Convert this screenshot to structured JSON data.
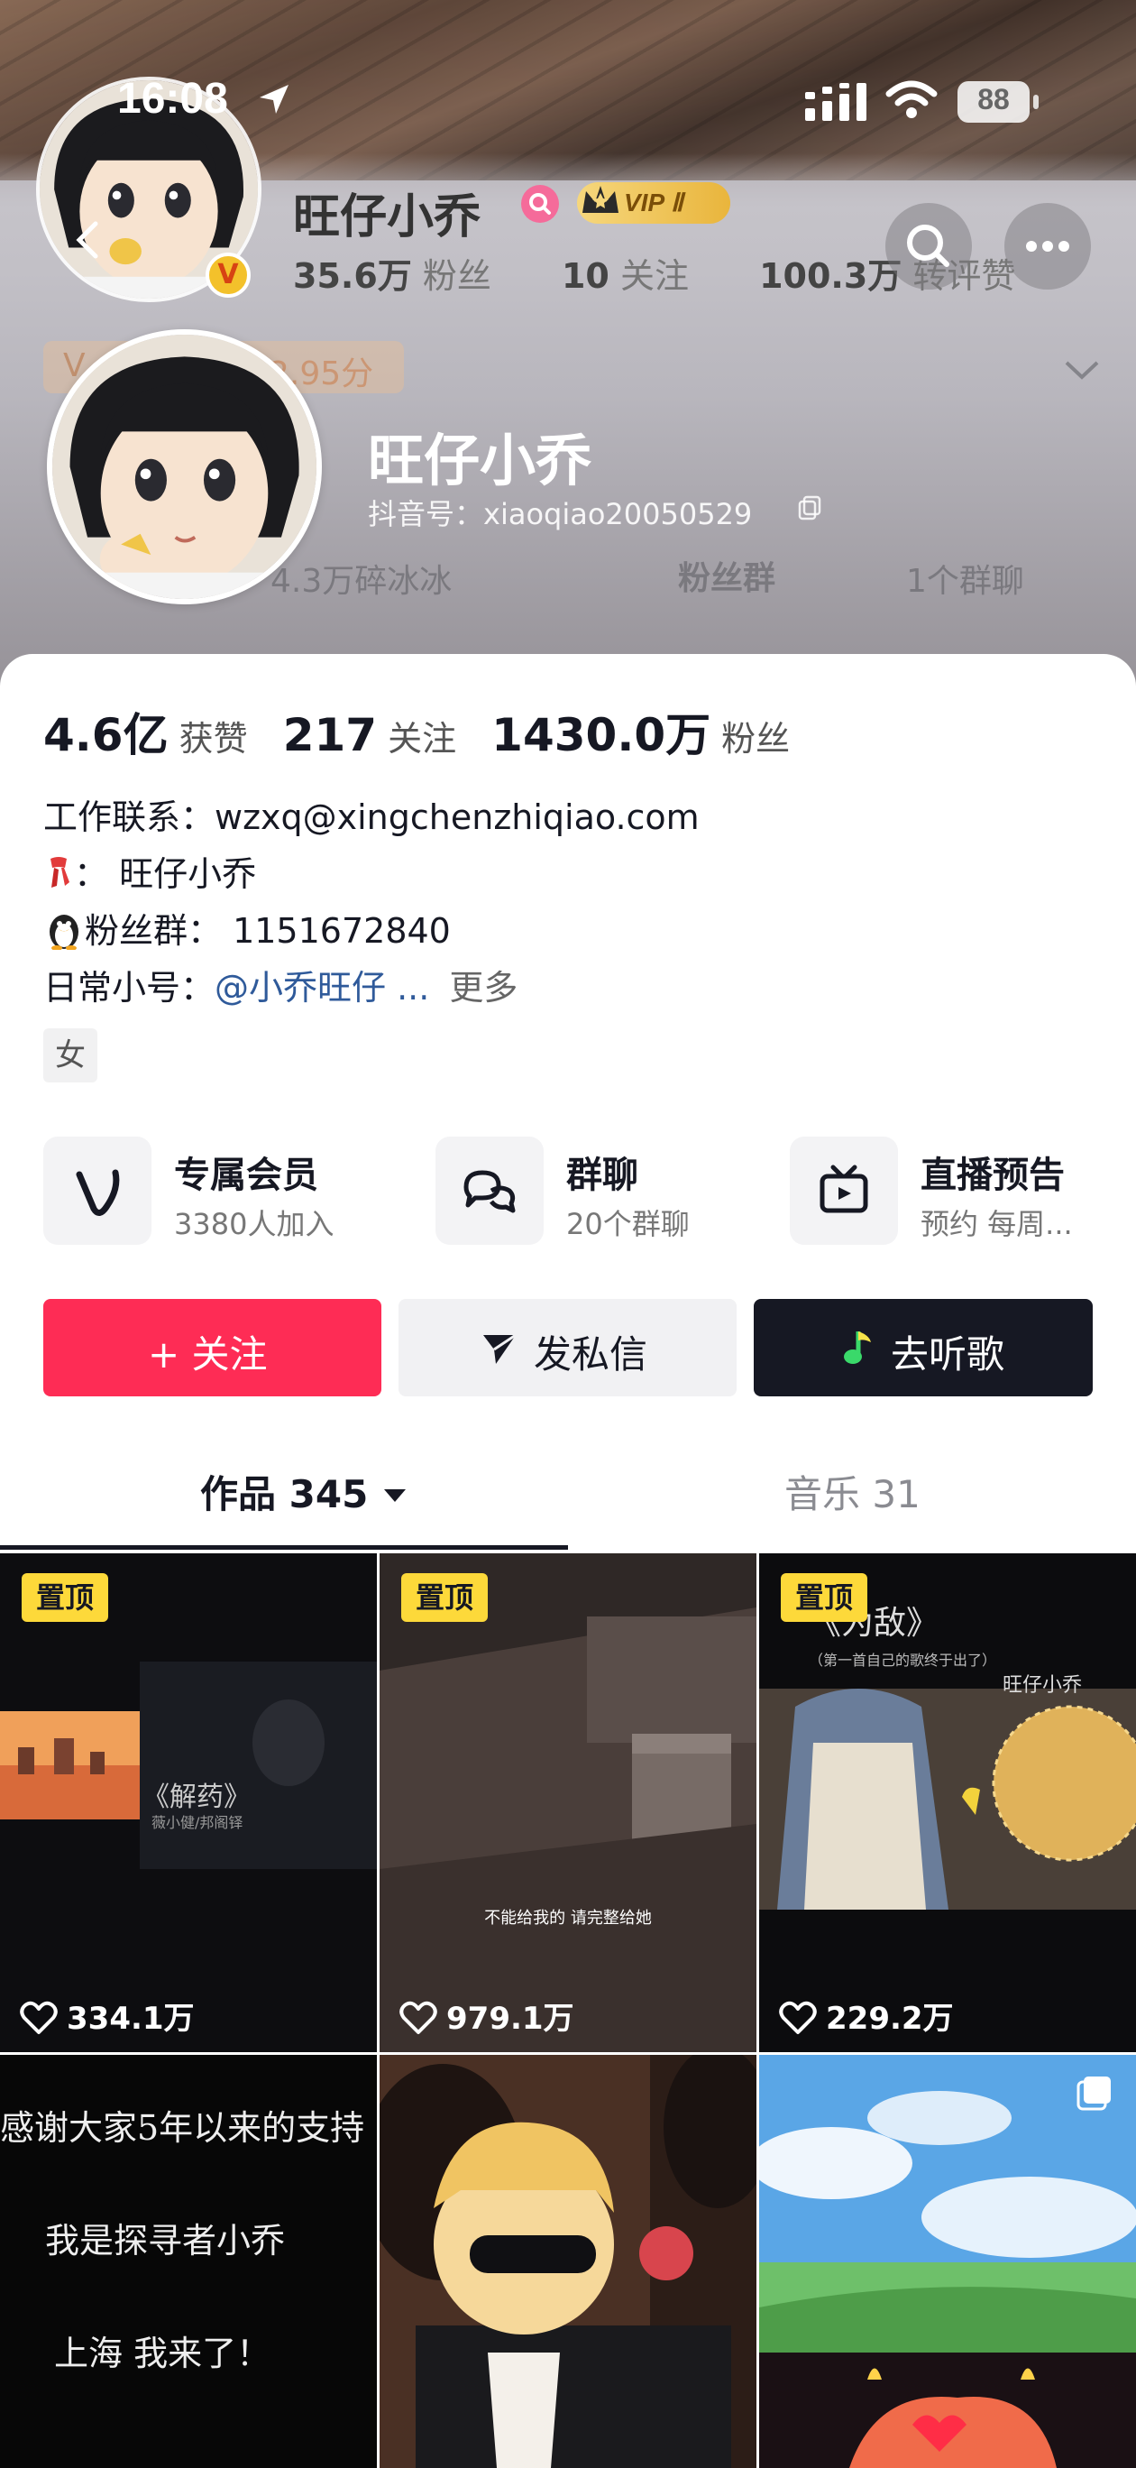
{
  "status_bar": {
    "time": "16:08",
    "battery": "88"
  },
  "sticky_header": {
    "name": "旺仔小乔",
    "vip_label": "VIP Ⅱ",
    "stats": [
      {
        "value": "35.6万",
        "label": "粉丝"
      },
      {
        "value": "10",
        "label": "关注"
      },
      {
        "value": "100.3万",
        "label": "转评赞"
      }
    ]
  },
  "header_ghost": {
    "vip_score": "V",
    "vip_score_tail": "2.95分",
    "ghost_left": "4.3万碎冰冰",
    "ghost_mid": "粉丝群",
    "ghost_right": "1个群聊"
  },
  "profile": {
    "name": "旺仔小乔",
    "douyin_id": "抖音号：xiaoqiao20050529"
  },
  "stats": [
    {
      "value": "4.6亿",
      "label": "获赞"
    },
    {
      "value": "217",
      "label": "关注"
    },
    {
      "value": "1430.0万",
      "label": "粉丝"
    }
  ],
  "bio": {
    "line1": "工作联系：wzxq@xingchenzhiqiao.com",
    "line2": "：  旺仔小乔",
    "line3": "粉丝群：  1151672840",
    "line4_prefix": "日常小号：",
    "line4_mention": "@小乔旺仔 ...",
    "line4_more": "更多",
    "gender": "女"
  },
  "features": [
    {
      "title": "专属会员",
      "sub": "3380人加入",
      "icon": "v-logo-icon"
    },
    {
      "title": "群聊",
      "sub": "20个群聊",
      "icon": "chat-bubbles-icon"
    },
    {
      "title": "直播预告",
      "sub": "预约 每周...",
      "icon": "tv-play-icon"
    }
  ],
  "buttons": {
    "follow": "+ 关注",
    "message": "发私信",
    "listen": "去听歌"
  },
  "tabs": {
    "works": "作品 345",
    "music": "音乐 31"
  },
  "grid": {
    "pin_label": "置顶",
    "cells": [
      {
        "likes": "334.1万",
        "caption": "《解药》",
        "subcaption": "薇小健/邦阁铎"
      },
      {
        "likes": "979.1万",
        "caption": "不能给我的 请完整给她"
      },
      {
        "likes": "229.2万",
        "caption": "《为敌》",
        "subcaption": "（第一首自己的歌终于出了）",
        "credit": "旺仔小乔"
      },
      {
        "lines": [
          "感谢大家5年以来的支持",
          "我是探寻者小乔",
          "上海  我来了！"
        ]
      },
      {},
      {}
    ]
  },
  "colors": {
    "brand_red": "#fe2c55",
    "dark": "#161823",
    "pin_yellow": "#fdd93a",
    "mention_blue": "#2f5a9a"
  }
}
